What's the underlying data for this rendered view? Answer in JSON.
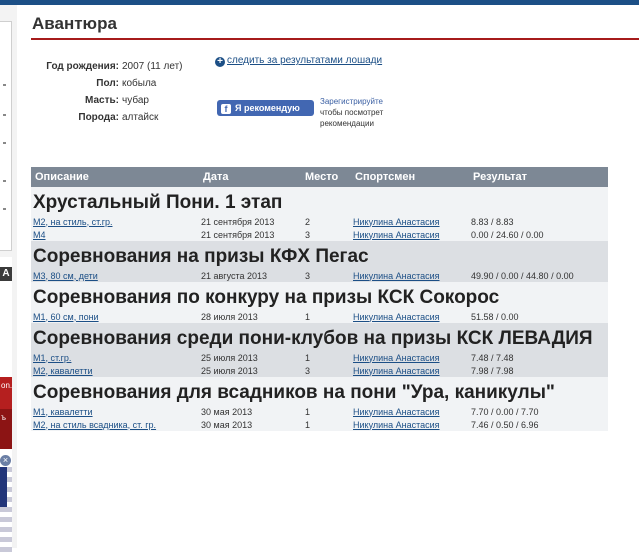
{
  "horse": {
    "name": "Авантюра",
    "fields": [
      {
        "label": "Год рождения:",
        "value": "2007 (11 лет)"
      },
      {
        "label": "Пол:",
        "value": "кобыла"
      },
      {
        "label": "Масть:",
        "value": "чубар"
      },
      {
        "label": "Порода:",
        "value": "алтайск"
      }
    ],
    "follow_link": "следить за результатами лошади",
    "fb_button": "Я рекомендую",
    "fb_note_link": "Зарегистрируйте",
    "fb_note_rest": "чтобы посмотрет рекомендации"
  },
  "ads": {
    "badge": "A",
    "text1": "on.",
    "text2": "ъ"
  },
  "table": {
    "headers": [
      "Описание",
      "Дата",
      "Место",
      "Спортсмен",
      "Результат"
    ],
    "competitions": [
      {
        "name": "Хрустальный Пони. 1 этап",
        "rows": [
          {
            "desc": "М2, на стиль, ст.гр.",
            "date": "21 сентября 2013",
            "place": "2",
            "rider": "Никулина Анастасия",
            "result": "8.83 / 8.83"
          },
          {
            "desc": "М4",
            "date": "21 сентября 2013",
            "place": "3",
            "rider": "Никулина Анастасия",
            "result": "0.00 / 24.60 / 0.00"
          }
        ]
      },
      {
        "name": "Соревнования на призы КФХ Пегас",
        "rows": [
          {
            "desc": "М3, 80 см, дети",
            "date": "21 августа 2013",
            "place": "3",
            "rider": "Никулина Анастасия",
            "result": "49.90 / 0.00 / 44.80 / 0.00"
          }
        ]
      },
      {
        "name": "Соревнования по конкуру на призы КСК Сокорос",
        "rows": [
          {
            "desc": "М1, 60 см, пони",
            "date": "28 июля 2013",
            "place": "1",
            "rider": "Никулина Анастасия",
            "result": "51.58 / 0.00"
          }
        ]
      },
      {
        "name": "Соревнования среди пони-клубов на призы КСК ЛЕВАДИЯ",
        "rows": [
          {
            "desc": "М1, ст.гр.",
            "date": "25 июля 2013",
            "place": "1",
            "rider": "Никулина Анастасия",
            "result": "7.48 / 7.48"
          },
          {
            "desc": "М2, кавалетти",
            "date": "25 июля 2013",
            "place": "3",
            "rider": "Никулина Анастасия",
            "result": "7.98 / 7.98"
          }
        ]
      },
      {
        "name": "Соревнования для всадников на пони \"Ура, каникулы\"",
        "rows": [
          {
            "desc": "М1, кавалетти",
            "date": "30 мая 2013",
            "place": "1",
            "rider": "Никулина Анастасия",
            "result": "7.70 / 0.00 / 7.70"
          },
          {
            "desc": "М2, на стиль всадника, ст. гр.",
            "date": "30 мая 2013",
            "place": "1",
            "rider": "Никулина Анастасия",
            "result": "7.46 / 0.50 / 6.96"
          }
        ]
      }
    ]
  }
}
